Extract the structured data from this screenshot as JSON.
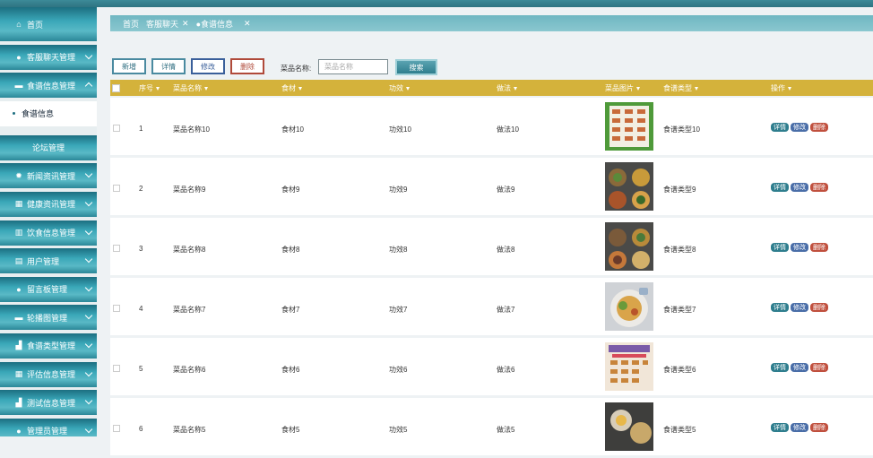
{
  "sidebar": {
    "home": "首页",
    "items": [
      {
        "label": "客服聊天管理",
        "icon": "shield-icon"
      },
      {
        "label": "食谱信息管理",
        "icon": "folder-icon",
        "expanded": true,
        "sub": "食谱信息"
      },
      {
        "label": "论坛管理",
        "icon": ""
      },
      {
        "label": "新闻资讯管理",
        "icon": "gear-icon"
      },
      {
        "label": "健康资讯管理",
        "icon": "grid-icon"
      },
      {
        "label": "饮食信息管理",
        "icon": "columns-icon"
      },
      {
        "label": "用户管理",
        "icon": "users-icon"
      },
      {
        "label": "留言板管理",
        "icon": "drop-icon"
      },
      {
        "label": "轮播图管理",
        "icon": "image-icon"
      },
      {
        "label": "食谱类型管理",
        "icon": "chart-icon"
      },
      {
        "label": "评估信息管理",
        "icon": "grid-icon"
      },
      {
        "label": "测试信息管理",
        "icon": "chart-icon"
      },
      {
        "label": "管理员管理",
        "icon": "user-icon"
      }
    ]
  },
  "tabs": {
    "home": "首页",
    "t1": "客服聊天",
    "t2": "食谱信息"
  },
  "toolbar": {
    "add": "新增",
    "detail": "详情",
    "edit": "修改",
    "delete": "删除",
    "search_label": "菜品名称:",
    "search_placeholder": "菜品名称",
    "search_btn": "搜索"
  },
  "table": {
    "headers": {
      "no": "序号",
      "name": "菜品名称",
      "ingredient": "食材",
      "effect": "功效",
      "method": "做法",
      "image": "菜品图片",
      "type": "食谱类型",
      "ops": "操作"
    },
    "rows": [
      {
        "no": "1",
        "name": "菜品名称10",
        "ingredient": "食材10",
        "effect": "功效10",
        "method": "做法10",
        "type": "食谱类型10"
      },
      {
        "no": "2",
        "name": "菜品名称9",
        "ingredient": "食材9",
        "effect": "功效9",
        "method": "做法9",
        "type": "食谱类型9"
      },
      {
        "no": "3",
        "name": "菜品名称8",
        "ingredient": "食材8",
        "effect": "功效8",
        "method": "做法8",
        "type": "食谱类型8"
      },
      {
        "no": "4",
        "name": "菜品名称7",
        "ingredient": "食材7",
        "effect": "功效7",
        "method": "做法7",
        "type": "食谱类型7"
      },
      {
        "no": "5",
        "name": "菜品名称6",
        "ingredient": "食材6",
        "effect": "功效6",
        "method": "做法6",
        "type": "食谱类型6"
      },
      {
        "no": "6",
        "name": "菜品名称5",
        "ingredient": "食材5",
        "effect": "功效5",
        "method": "做法5",
        "type": "食谱类型5"
      }
    ],
    "op_detail": "详情",
    "op_edit": "修改",
    "op_delete": "删除"
  },
  "colors": {
    "accent": "#2f7e8e",
    "header": "#d4b23b",
    "sidebar": "#3aa7b8"
  }
}
